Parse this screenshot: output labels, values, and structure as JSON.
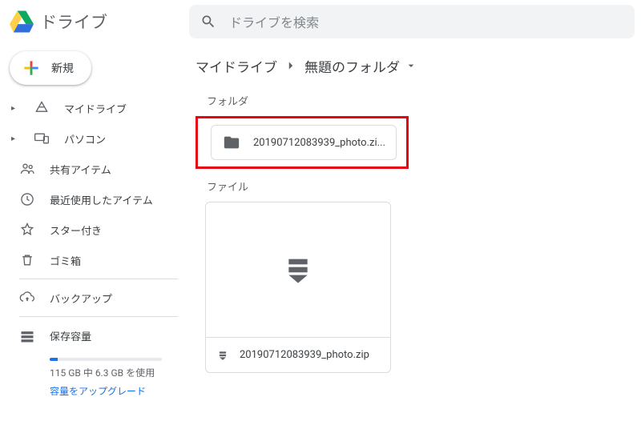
{
  "brand": {
    "name": "ドライブ"
  },
  "search": {
    "placeholder": "ドライブを検索"
  },
  "newButton": {
    "label": "新規"
  },
  "sidebar": {
    "items": [
      {
        "label": "マイドライブ"
      },
      {
        "label": "パソコン"
      },
      {
        "label": "共有アイテム"
      },
      {
        "label": "最近使用したアイテム"
      },
      {
        "label": "スター付き"
      },
      {
        "label": "ゴミ箱"
      },
      {
        "label": "バックアップ"
      }
    ],
    "storage": {
      "label": "保存容量",
      "usage": "115 GB 中 6.3 GB を使用",
      "upgrade": "容量をアップグレード"
    }
  },
  "breadcrumb": {
    "root": "マイドライブ",
    "current": "無題のフォルダ"
  },
  "sections": {
    "folders": "フォルダ",
    "files": "ファイル"
  },
  "folder": {
    "name": "20190712083939_photo.zi..."
  },
  "file": {
    "name": "20190712083939_photo.zip"
  }
}
